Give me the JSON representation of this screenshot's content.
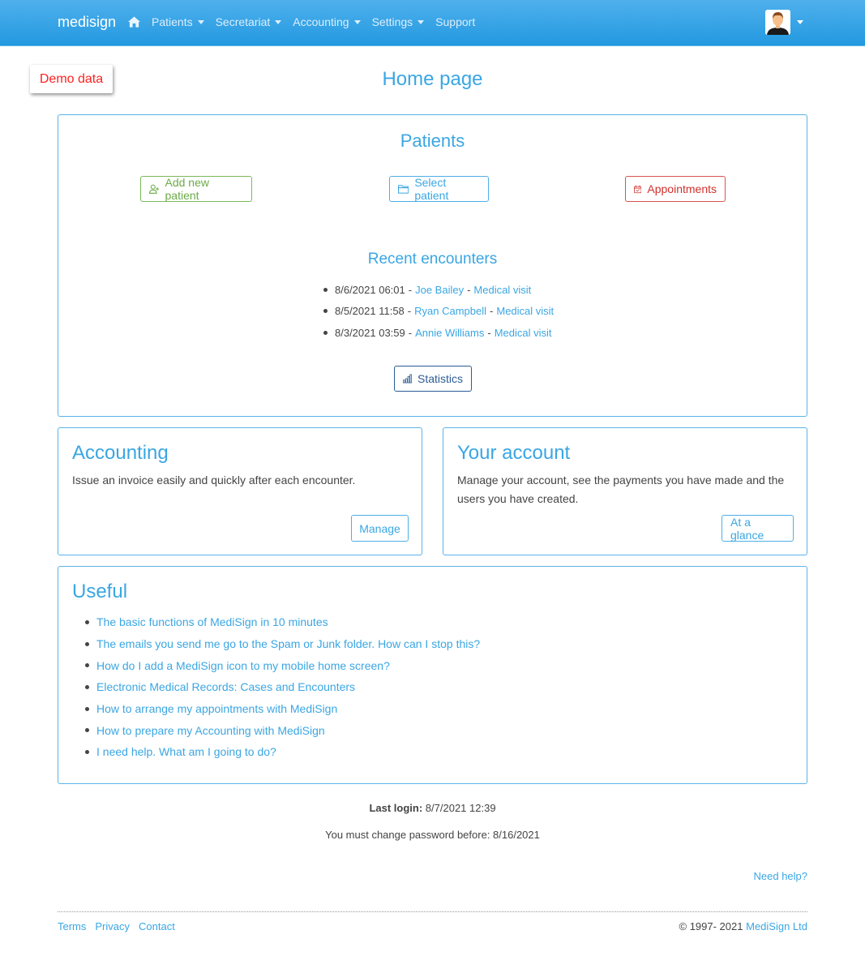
{
  "navbar": {
    "brand": "medisign",
    "home_icon": "home-icon",
    "items": [
      {
        "label": "Patients",
        "dropdown": true
      },
      {
        "label": "Secretariat",
        "dropdown": true
      },
      {
        "label": "Accounting",
        "dropdown": true
      },
      {
        "label": "Settings",
        "dropdown": true
      },
      {
        "label": "Support",
        "dropdown": false
      }
    ],
    "avatar_icon": "user-avatar-icon"
  },
  "demo_badge": "Demo data",
  "page_title": "Home page",
  "patients": {
    "title": "Patients",
    "buttons": {
      "add_new_patient": "Add new patient",
      "select_patient": "Select patient",
      "appointments": "Appointments"
    },
    "recent_title": "Recent encounters",
    "encounters": [
      {
        "datetime": "8/6/2021 06:01",
        "patient": "Joe Bailey",
        "type": "Medical visit"
      },
      {
        "datetime": "8/5/2021 11:58",
        "patient": "Ryan Campbell",
        "type": "Medical visit"
      },
      {
        "datetime": "8/3/2021 03:59",
        "patient": "Annie Williams",
        "type": "Medical visit"
      }
    ],
    "statistics": "Statistics"
  },
  "accounting": {
    "title": "Accounting",
    "text": "Issue an invoice easily and quickly after each encounter.",
    "button": "Manage"
  },
  "your_account": {
    "title": "Your account",
    "text": "Manage your account, see the payments you have made and the users you have created.",
    "button": "At a glance"
  },
  "useful": {
    "title": "Useful",
    "links": [
      "The basic functions of MediSign in 10 minutes",
      "The emails you send me go to the Spam or Junk folder. How can I stop this?",
      "How do I add a MediSign icon to my mobile home screen?",
      "Electronic Medical Records: Cases and Encounters",
      "How to arrange my appointments with MediSign",
      "How to prepare my Accounting with MediSign",
      "I need help. What am I going to do?"
    ]
  },
  "status": {
    "last_login_label": "Last login:",
    "last_login_value": "8/7/2021 12:39",
    "password_note": "You must change password before: 8/16/2021"
  },
  "need_help": "Need help?",
  "footer": {
    "links": [
      "Terms",
      "Privacy",
      "Contact"
    ],
    "copyright_prefix": "© 1997- 2021",
    "company": "MediSign Ltd"
  },
  "colors": {
    "navbar": "#2399e0",
    "accent": "#3aa6e3",
    "green": "#6aab46",
    "red": "#d0312d",
    "navy": "#2c5c94",
    "demo_red": "#ff1f1f"
  }
}
